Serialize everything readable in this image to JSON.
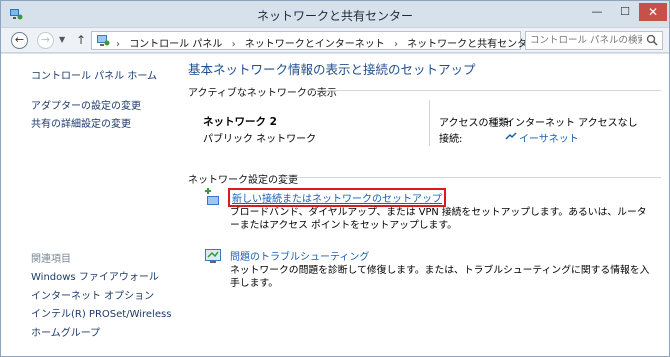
{
  "window": {
    "title": "ネットワークと共有センター",
    "minimize": "—",
    "maximize": "☐",
    "close": "✕"
  },
  "address": {
    "crumbs": [
      "コントロール パネル",
      "ネットワークとインターネット",
      "ネットワークと共有センター"
    ],
    "search_placeholder": "コントロール パネルの検索"
  },
  "sidebar": {
    "home": "コントロール パネル ホーム",
    "links": [
      "アダプターの設定の変更",
      "共有の詳細設定の変更"
    ],
    "related_heading": "関連項目",
    "related": [
      "Windows ファイアウォール",
      "インターネット オプション",
      "インテル(R) PROSet/Wireless",
      "ホームグループ"
    ]
  },
  "main": {
    "title": "基本ネットワーク情報の表示と接続のセットアップ",
    "active_heading": "アクティブなネットワークの表示",
    "network_name": "ネットワーク 2",
    "network_type": "パブリック ネットワーク",
    "access_label": "アクセスの種類:",
    "access_value": "インターネット アクセスなし",
    "conn_label": "接続:",
    "conn_value": "イーサネット",
    "change_heading": "ネットワーク設定の変更",
    "task1_link": "新しい接続またはネットワークのセットアップ",
    "task1_desc": "ブロードバンド、ダイヤルアップ、または VPN 接続をセットアップします。あるいは、ルーターまたはアクセス ポイントをセットアップします。",
    "task2_link": "問題のトラブルシューティング",
    "task2_desc": "ネットワークの問題を診断して修復します。または、トラブルシューティングに関する情報を入手します。"
  },
  "colors": {
    "link": "#1a5fb4",
    "title": "#1f4e8c",
    "highlight": "#d61c1c"
  }
}
